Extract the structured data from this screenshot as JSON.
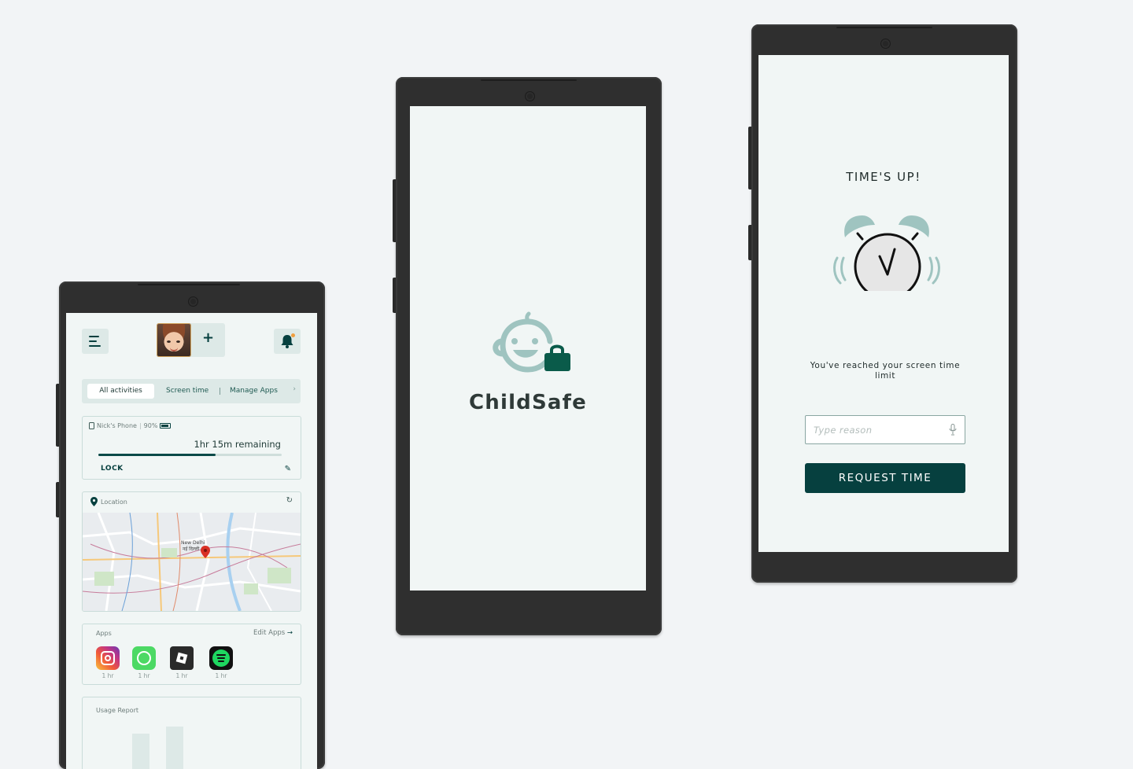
{
  "dashboard": {
    "tabs": [
      "All activities",
      "Screen time",
      "Manage Apps"
    ],
    "device": {
      "name": "Nick's Phone",
      "battery": "90%"
    },
    "remaining": "1hr 15m remaining",
    "screen_time_used_fraction": 0.64,
    "lock_label": "LOCK",
    "location_label": "Location",
    "map_labels": {
      "city": "New Delhi",
      "city_hindi": "नई दिल्ली"
    },
    "apps_label": "Apps",
    "edit_apps_label": "Edit Apps",
    "apps": [
      {
        "icon": "instagram-icon",
        "time": "1 hr"
      },
      {
        "icon": "whatsapp-icon",
        "time": "1 hr"
      },
      {
        "icon": "roblox-icon",
        "time": "1 hr"
      },
      {
        "icon": "spotify-icon",
        "time": "1 hr"
      }
    ],
    "usage_report_label": "Usage Report"
  },
  "splash": {
    "brand": "ChildSafe"
  },
  "timesup": {
    "title": "TIME'S UP!",
    "message": "You've reached your screen time limit",
    "reason_placeholder": "Type reason",
    "request_button": "REQUEST TIME"
  },
  "colors": {
    "primary": "#06403f",
    "accent_light": "#9fc4c0",
    "background": "#f1f6f5"
  }
}
